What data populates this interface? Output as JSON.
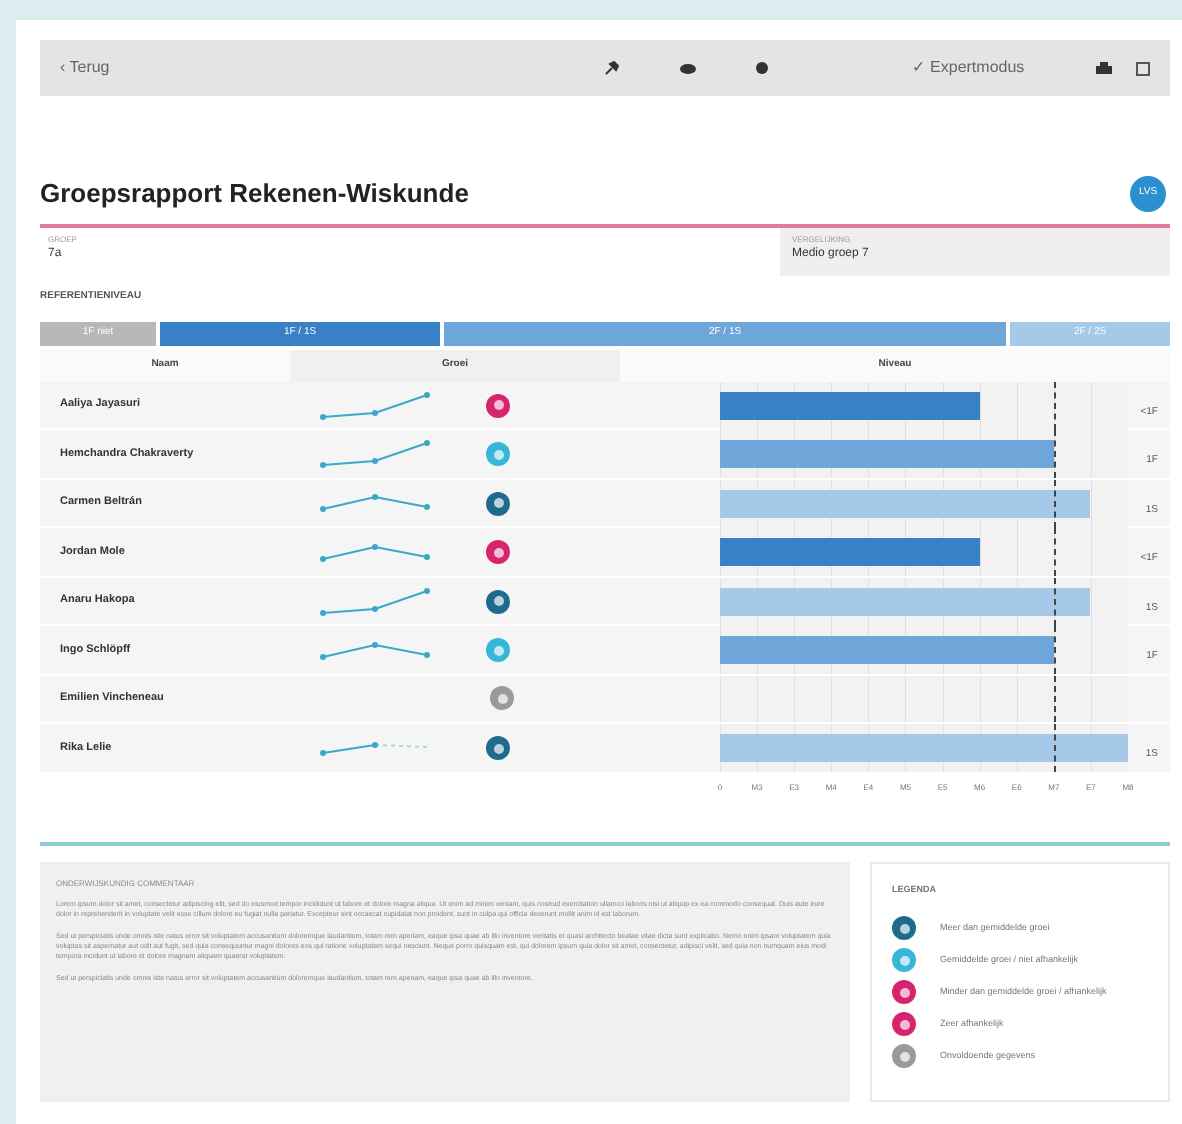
{
  "toolbar": {
    "back": "‹ Terug",
    "expert": "✓ Expertmodus"
  },
  "title": "Groepsrapport Rekenen-Wiskunde",
  "logo": "LVS",
  "info": [
    {
      "label": "GROEP",
      "value": "7a"
    },
    {
      "label": "VERGELIJKING",
      "value": "Medio groep 7"
    }
  ],
  "reference_label": "REFERENTIENIVEAU",
  "reference_bands": [
    {
      "label": "1F niet",
      "color": "#b8b8b8"
    },
    {
      "label": "1F / 1S",
      "color": "#3a80c6"
    },
    {
      "label": "2F / 1S",
      "color": "#6fa6da"
    },
    {
      "label": "2F / 2S",
      "color": "#a6c8e9"
    }
  ],
  "table": {
    "columns": [
      "Naam",
      "Groei",
      "Niveau"
    ],
    "rows": [
      {
        "name": "Aaliya Jayasuri",
        "kind": "up",
        "color": "#d6246e",
        "bar": {
          "level": 0.636,
          "color": "#3a80c6"
        },
        "level_text": "<1F"
      },
      {
        "name": "Hemchandra Chakraverty",
        "kind": "up",
        "color": "#36b6d8",
        "bar": {
          "level": 0.818,
          "color": "#6fa6da"
        },
        "level_text": "1F"
      },
      {
        "name": "Carmen Beltrán",
        "kind": "hump",
        "color": "#1f6b8e",
        "bar": {
          "level": 0.909,
          "color": "#a6c8e9"
        },
        "level_text": "1S"
      },
      {
        "name": "Jordan Mole",
        "kind": "hump",
        "color": "#d6246e",
        "bar": {
          "level": 0.636,
          "color": "#3a80c6"
        },
        "level_text": "<1F"
      },
      {
        "name": "Anaru Hakopa",
        "kind": "up",
        "color": "#1f6b8e",
        "bar": {
          "level": 0.909,
          "color": "#a6c8e9"
        },
        "level_text": "1S"
      },
      {
        "name": "Ingo Schlöpff",
        "kind": "hump",
        "color": "#36b6d8",
        "bar": {
          "level": 0.818,
          "color": "#6fa6da"
        },
        "level_text": "1F"
      },
      {
        "name": "Emilien Vincheneau",
        "kind": "none",
        "color": "#9a9a9a"
      },
      {
        "name": "Rika Lelie",
        "kind": "partial",
        "color": "#1f6b8e",
        "bar": {
          "level": 1,
          "color": "#a6c8e9"
        },
        "level_text": "1S"
      }
    ],
    "reference_line": {
      "level": 0.818
    },
    "axis_ticks": [
      "0",
      "M3",
      "E3",
      "M4",
      "E4",
      "M5",
      "E5",
      "M6",
      "E6",
      "M7",
      "E7",
      "M8"
    ]
  },
  "comment": {
    "title": "ONDERWIJSKUNDIG COMMENTAAR",
    "paragraphs": [
      "Lorem ipsum dolor sit amet, consectetur adipiscing elit, sed do eiusmod tempor incididunt ut labore et dolore magna aliqua. Ut enim ad minim veniam, quis nostrud exercitation ullamco laboris nisi ut aliquip ex ea commodo consequat. Duis aute irure dolor in reprehenderit in voluptate velit esse cillum dolore eu fugiat nulla pariatur. Excepteur sint occaecat cupidatat non proident, sunt in culpa qui officia deserunt mollit anim id est laborum.",
      "Sed ut perspiciatis unde omnis iste natus error sit voluptatem accusantium doloremque laudantium, totam rem aperiam, eaque ipsa quae ab illo inventore veritatis et quasi architecto beatae vitae dicta sunt explicabo. Nemo enim ipsam voluptatem quia voluptas sit aspernatur aut odit aut fugit, sed quia consequuntur magni dolores eos qui ratione voluptatem sequi nesciunt. Neque porro quisquam est, qui dolorem ipsum quia dolor sit amet, consectetur, adipisci velit, sed quia non numquam eius modi tempora incidunt ut labore et dolore magnam aliquam quaerat voluptatem.",
      "Sed ut perspiciatis unde omnis iste natus error sit voluptatem accusantium doloremque laudantium, totam rem aperiam, eaque ipsa quae ab illo inventore."
    ]
  },
  "legend": {
    "title": "LEGENDA",
    "items": [
      {
        "color": "#1f6b8e",
        "label": "Meer dan gemiddelde groei"
      },
      {
        "color": "#36b6d8",
        "label": "Gemiddelde groei / niet afhankelijk"
      },
      {
        "color": "#d6246e",
        "label": "Minder dan gemiddelde groei / afhankelijk"
      },
      {
        "color": "#d6246e",
        "label": "Zeer afhankelijk"
      },
      {
        "color": "#9a9a9a",
        "label": "Onvoldoende gegevens"
      }
    ]
  }
}
